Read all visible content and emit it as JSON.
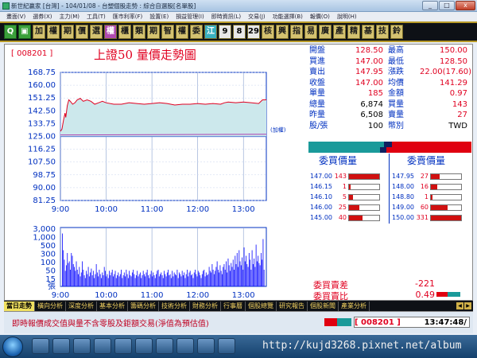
{
  "window": {
    "title": "新世紀贏家 [台灣] - 104/01/08 - 台塑個股走勢 : 綜合自選股[名單股]",
    "controls": [
      "_",
      "□",
      "x"
    ]
  },
  "menu": [
    "畫面(V)",
    "選券(X)",
    "主力(M)",
    "工具(T)",
    "匯市利率(F)",
    "設置(E)",
    "損益管理(I)",
    "即時資訊(L)",
    "交易(J)",
    "功能選擇(B)",
    "報價(O)",
    "說明(H)"
  ],
  "toolbar": [
    "Q",
    "▣",
    "加",
    "權",
    "期",
    "價",
    "選",
    "權",
    "櫃",
    "類",
    "期",
    "智",
    "權",
    "委",
    "江",
    "9",
    "8",
    "29",
    "核",
    "興",
    "指",
    "易",
    "廣",
    "產",
    "精",
    "基",
    "技",
    "鈴"
  ],
  "header": {
    "code": "[ 008201 ]",
    "title": "上證50  量價走勢圖"
  },
  "chart_data": {
    "type": "line",
    "price_ticks": [
      "168.75",
      "160.00",
      "151.25",
      "142.50",
      "133.75",
      "125.00",
      "116.25",
      "107.50",
      "98.75",
      "90.00",
      "81.25"
    ],
    "volume_ticks": [
      "3,000",
      "1,000",
      "500",
      "300",
      "100",
      "50",
      "15"
    ],
    "volume_unit_label": "張",
    "x_ticks": [
      "9:00",
      "10:00",
      "11:00",
      "12:00",
      "13:00"
    ],
    "ylim": [
      81.25,
      168.75
    ],
    "reference_price": 125.0,
    "reference_label": "(加權)",
    "price_series": {
      "x": [
        0,
        2,
        4,
        6,
        7,
        9,
        11,
        13,
        16,
        19,
        22,
        26,
        30,
        35,
        40,
        45,
        50,
        55,
        60,
        70,
        80,
        90,
        100,
        110,
        120,
        130,
        140,
        150,
        160,
        170,
        180,
        190,
        200,
        210,
        215,
        220,
        230,
        240,
        250,
        260,
        265,
        270
      ],
      "y": [
        128.5,
        130,
        136,
        141,
        138,
        146,
        150,
        149,
        147,
        148,
        150,
        151,
        149,
        150,
        149,
        147,
        148,
        149,
        148,
        147,
        147,
        148,
        147.5,
        147,
        147.5,
        148,
        147.5,
        146.5,
        147,
        147,
        147.5,
        147,
        147.5,
        147,
        148,
        148.5,
        148,
        148.5,
        148,
        147.5,
        150,
        150
      ]
    },
    "index_series": {
      "x": [
        0,
        270
      ],
      "y": [
        126,
        126.5
      ]
    },
    "volume_bars": [
      95,
      65,
      48,
      28,
      38,
      60,
      42,
      45,
      30,
      60,
      55,
      40,
      35,
      28,
      45,
      30,
      22,
      35,
      18,
      25,
      45,
      30,
      20,
      15,
      28,
      22,
      35,
      18,
      25,
      32,
      20,
      28,
      15,
      22,
      40,
      25,
      18,
      30,
      22,
      15,
      25,
      20,
      35,
      28,
      18,
      22,
      15,
      28,
      20,
      25,
      30,
      18,
      22,
      28,
      15,
      20,
      25,
      18,
      22,
      30,
      15,
      20,
      25,
      18,
      30,
      22,
      15,
      28,
      20,
      18,
      25,
      30,
      22,
      15,
      20,
      28,
      18,
      22,
      25,
      15,
      20,
      28,
      22,
      18,
      25,
      30,
      20,
      15,
      22,
      28,
      18,
      25,
      20,
      15,
      22,
      28,
      30,
      18,
      22,
      25,
      20,
      15,
      28,
      22,
      18,
      25,
      30,
      20,
      22,
      15,
      28,
      18,
      25,
      22,
      20,
      30,
      15,
      25,
      22,
      18,
      28,
      20,
      25,
      15,
      22,
      30,
      18,
      25,
      28,
      20,
      22,
      15,
      25,
      30,
      22,
      18,
      28,
      25,
      20,
      15,
      22,
      28,
      30,
      18,
      25,
      20,
      22,
      35,
      28,
      25,
      40,
      30,
      22,
      28,
      35,
      45,
      30,
      25,
      38,
      28,
      22,
      35,
      40,
      30,
      45,
      25,
      50,
      38,
      28,
      42,
      35,
      48,
      30,
      55,
      40,
      60,
      35,
      65,
      45,
      38,
      52,
      30,
      70,
      45,
      55,
      40,
      35,
      60,
      48,
      30,
      65,
      40,
      50,
      35,
      75,
      45,
      55,
      42,
      38,
      60,
      48,
      85,
      30
    ]
  },
  "quote": {
    "rows": [
      {
        "l1": "開盤",
        "v1": "128.50",
        "c1": "red",
        "l2": "最高",
        "v2": "150.00",
        "c2": "red"
      },
      {
        "l1": "買進",
        "v1": "147.00",
        "c1": "red",
        "l2": "最低",
        "v2": "128.50",
        "c2": "red"
      },
      {
        "l1": "賣出",
        "v1": "147.95",
        "c1": "red",
        "l2": "漲跌",
        "v2": "22.00(17.60)",
        "c2": "red"
      },
      {
        "l1": "收盤",
        "v1": "147.00",
        "c1": "red",
        "l2": "均價",
        "v2": "141.29",
        "c2": "red"
      },
      {
        "l1": "單量",
        "v1": "185",
        "c1": "red",
        "l2": "金額",
        "v2": "0.97",
        "c2": "red"
      },
      {
        "l1": "總量",
        "v1": "6,874",
        "c1": "blk",
        "l2": "買量",
        "v2": "143",
        "c2": "red"
      },
      {
        "l1": "昨量",
        "v1": "6,508",
        "c1": "blk",
        "l2": "賣量",
        "v2": "27",
        "c2": "red"
      },
      {
        "l1": "股/張",
        "v1": "100",
        "c1": "blk",
        "l2": "幣別",
        "v2": "TWD",
        "c2": "blk"
      }
    ]
  },
  "orderbook": {
    "bid_header": "委買價量",
    "ask_header": "委賣價量",
    "bids": [
      {
        "price": "147.00",
        "vol": "143",
        "fill": 1.0
      },
      {
        "price": "146.15",
        "vol": "1",
        "fill": 0.06
      },
      {
        "price": "146.10",
        "vol": "5",
        "fill": 0.12
      },
      {
        "price": "146.00",
        "vol": "25",
        "fill": 0.35
      },
      {
        "price": "145.00",
        "vol": "40",
        "fill": 0.45
      }
    ],
    "asks": [
      {
        "price": "147.95",
        "vol": "27",
        "fill": 0.3
      },
      {
        "price": "148.00",
        "vol": "16",
        "fill": 0.22
      },
      {
        "price": "148.80",
        "vol": "1",
        "fill": 0.05
      },
      {
        "price": "149.00",
        "vol": "60",
        "fill": 0.55
      },
      {
        "price": "150.00",
        "vol": "331",
        "fill": 1.0
      }
    ]
  },
  "ratio": {
    "diff_label": "委買賣差",
    "diff_value": "-221",
    "ratio_label": "委買賣比",
    "ratio_value": "0.49"
  },
  "tabs": [
    "當日走勢",
    "橫向分析",
    "深度分析",
    "基本分析",
    "籌碼分析",
    "技術分析",
    "財務分析",
    "行事曆",
    "個股總覽",
    "研究報告",
    "個股新聞",
    "產業分析"
  ],
  "status": {
    "scroll_text": "即時報價成交值與量不含零股及鉅額交易(淨值為預估值)",
    "code": "[ 008201 ]",
    "time": "13:47:48/"
  },
  "taskbar": {
    "url_text": "http://kujd3268.pixnet.net/album"
  }
}
